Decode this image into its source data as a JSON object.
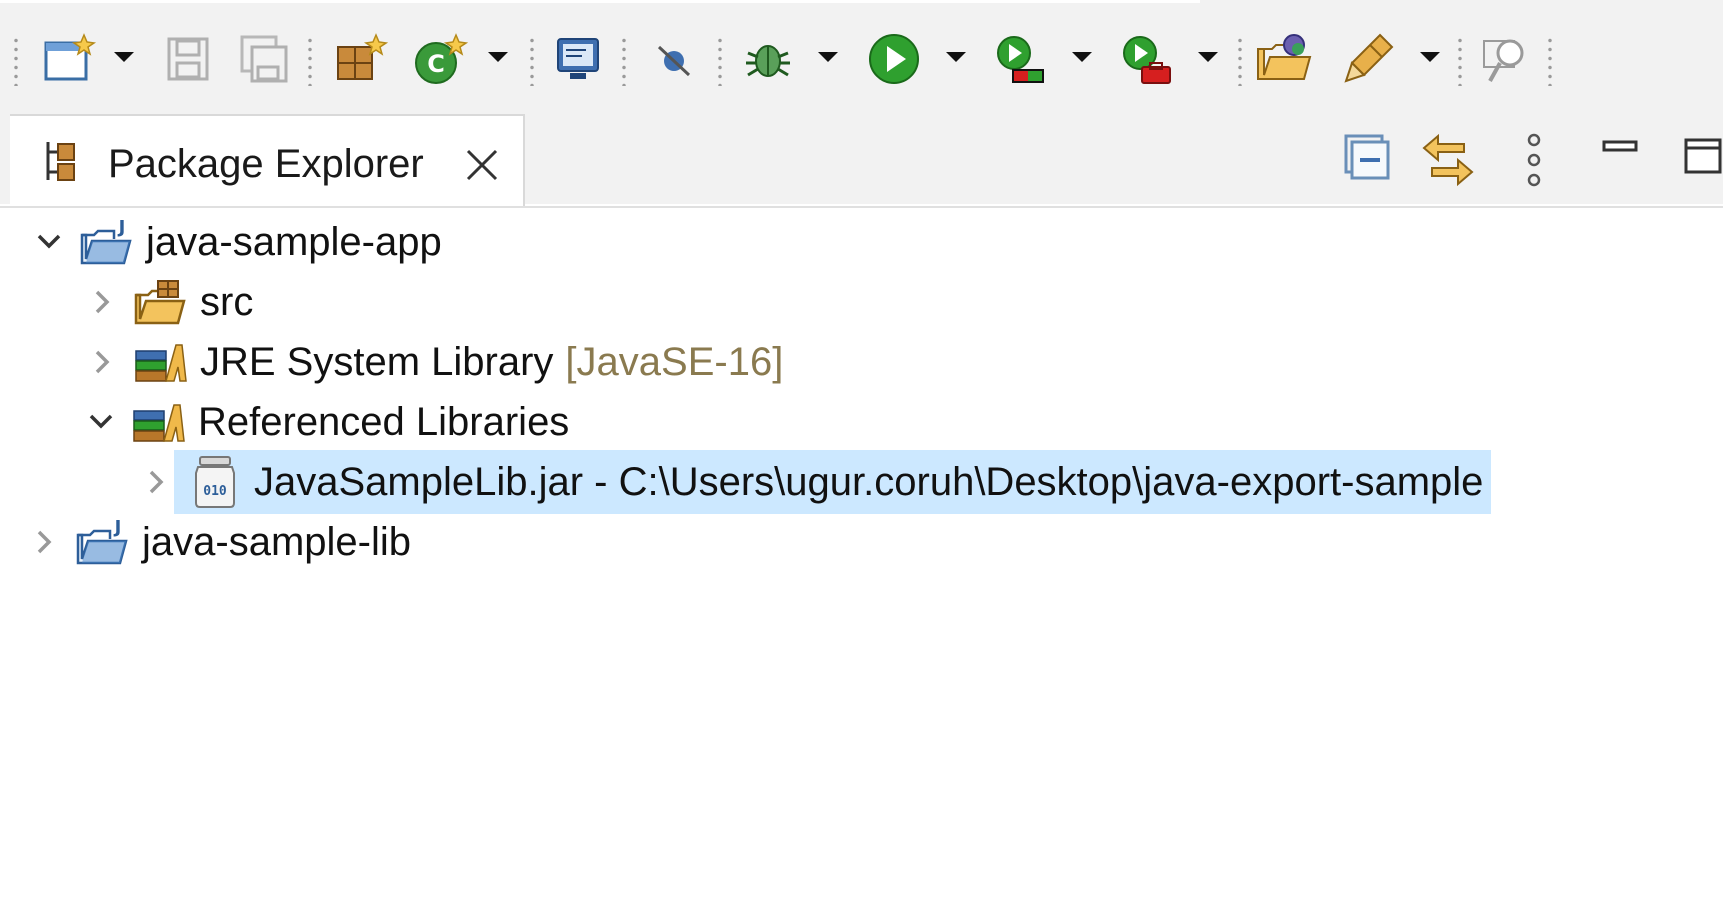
{
  "toolbar": {
    "items": [
      {
        "name": "new-wizard-icon"
      },
      {
        "name": "save-icon"
      },
      {
        "name": "save-all-icon"
      },
      {
        "name": "new-java-package-icon"
      },
      {
        "name": "new-java-class-icon"
      },
      {
        "name": "open-console-icon"
      },
      {
        "name": "skip-breakpoints-icon"
      },
      {
        "name": "debug-icon"
      },
      {
        "name": "run-icon"
      },
      {
        "name": "coverage-icon"
      },
      {
        "name": "external-tools-icon"
      },
      {
        "name": "open-type-icon"
      },
      {
        "name": "open-task-icon"
      },
      {
        "name": "search-icon"
      }
    ]
  },
  "view": {
    "tab_title": "Package Explorer",
    "buttons": [
      "collapse-all-icon",
      "link-with-editor-icon",
      "view-menu-icon",
      "minimize-icon",
      "maximize-icon"
    ]
  },
  "tree": {
    "nodes": [
      {
        "label": "java-sample-app",
        "decoration": "",
        "expanded": true,
        "icon": "java-project-icon"
      },
      {
        "label": "src",
        "decoration": "",
        "expanded": false,
        "icon": "source-folder-icon"
      },
      {
        "label": "JRE System Library",
        "decoration": "[JavaSE-16]",
        "expanded": false,
        "icon": "library-icon"
      },
      {
        "label": "Referenced Libraries",
        "decoration": "",
        "expanded": true,
        "icon": "library-icon"
      },
      {
        "label": "JavaSampleLib.jar - C:\\Users\\ugur.coruh\\Desktop\\java-export-sample",
        "decoration": "",
        "expanded": false,
        "icon": "jar-icon",
        "selected": true
      },
      {
        "label": "java-sample-lib",
        "decoration": "",
        "expanded": false,
        "icon": "java-project-icon"
      }
    ]
  },
  "colors": {
    "selection": "#cce8ff",
    "toolbar_bg": "#f2f2f2",
    "decoration_text": "#8a7a4f"
  }
}
